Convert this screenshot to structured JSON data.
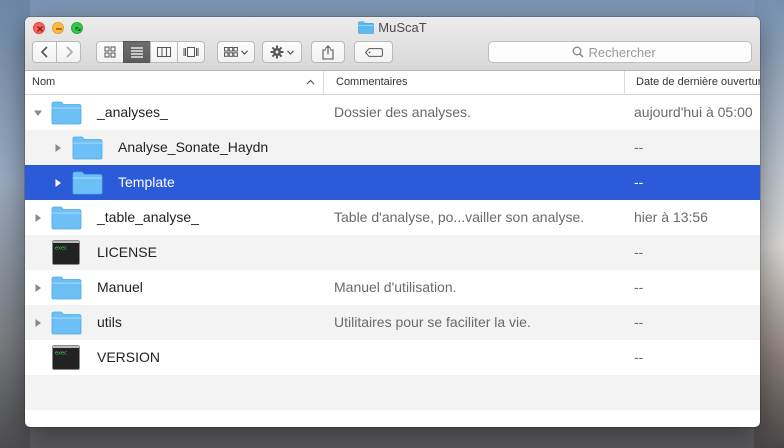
{
  "window": {
    "title": "MuScaT"
  },
  "toolbar": {
    "back_tip": "back",
    "forward_tip": "forward",
    "search_placeholder": "Rechercher"
  },
  "columns": {
    "name": "Nom",
    "comments": "Commentaires",
    "date": "Date de dernière ouverture"
  },
  "rows": [
    {
      "name": "_analyses_",
      "comment": "Dossier des analyses.",
      "date": "aujourd'hui à 05:00",
      "kind": "folder",
      "expanded": true
    },
    {
      "name": "Analyse_Sonate_Haydn",
      "comment": "",
      "date": "--",
      "kind": "folder",
      "expanded": false
    },
    {
      "name": "Template",
      "comment": "",
      "date": "--",
      "kind": "folder",
      "expanded": false,
      "selected": true
    },
    {
      "name": "_table_analyse_",
      "comment": "Table d'analyse, po...vailler son analyse.",
      "date": "hier à 13:56",
      "kind": "folder",
      "expanded": false
    },
    {
      "name": "LICENSE",
      "comment": "",
      "date": "--",
      "kind": "exec",
      "exec_label": "exec"
    },
    {
      "name": "Manuel",
      "comment": "Manuel d'utilisation.",
      "date": "--",
      "kind": "folder",
      "expanded": false
    },
    {
      "name": "utils",
      "comment": "Utilitaires pour se faciliter la vie.",
      "date": "--",
      "kind": "folder",
      "expanded": false
    },
    {
      "name": "VERSION",
      "comment": "",
      "date": "--",
      "kind": "exec",
      "exec_label": "exec"
    }
  ],
  "colors": {
    "selection": "#2b5bd8",
    "folder": "#6cc0f5",
    "alt_row": "#f3f3f3"
  }
}
